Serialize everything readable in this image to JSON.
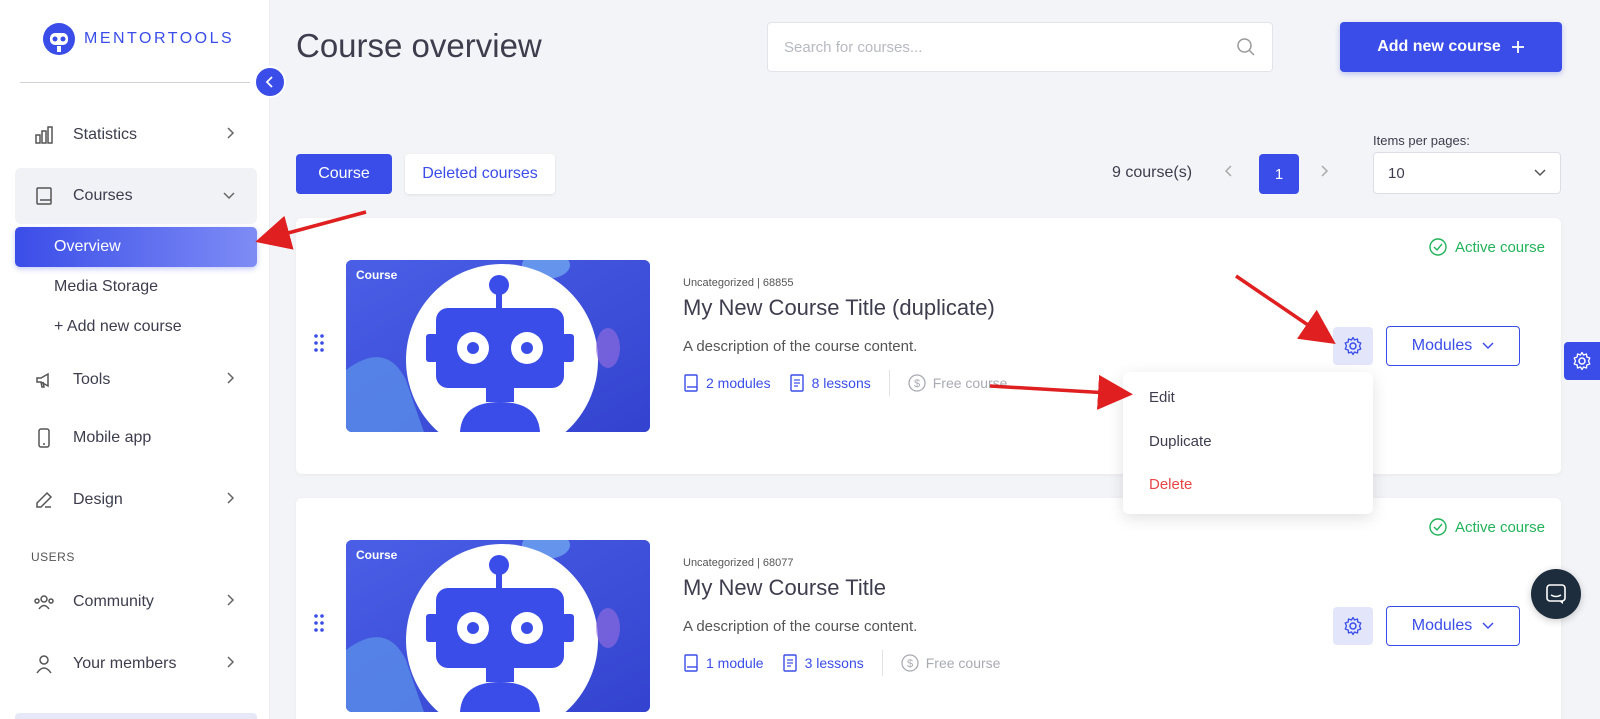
{
  "brand": {
    "name": "MENTORTOOLS"
  },
  "sidebar": {
    "items": [
      {
        "label": "Statistics",
        "icon": "bar-chart-icon"
      },
      {
        "label": "Courses",
        "icon": "book-icon"
      },
      {
        "label": "Tools",
        "icon": "megaphone-icon"
      },
      {
        "label": "Mobile app",
        "icon": "phone-icon"
      },
      {
        "label": "Design",
        "icon": "pencil-icon"
      }
    ],
    "courses_sub": {
      "overview": "Overview",
      "media": "Media Storage",
      "add": "+ Add new course"
    },
    "users_section": "USERS",
    "users_items": [
      {
        "label": "Community",
        "icon": "community-icon"
      },
      {
        "label": "Your members",
        "icon": "user-icon"
      }
    ]
  },
  "header": {
    "title": "Course overview",
    "search_placeholder": "Search for courses...",
    "add_button": "Add new course"
  },
  "toolbar": {
    "tabs": [
      "Course",
      "Deleted courses"
    ],
    "count": "9 course(s)",
    "page": "1",
    "items_per_page_label": "Items per pages:",
    "items_per_page_value": "10"
  },
  "courses": [
    {
      "thumb_label": "Course",
      "category": "Uncategorized | 68855",
      "title": "My New Course Title (duplicate)",
      "description": "A description of the course content.",
      "modules": "2 modules",
      "lessons": "8 lessons",
      "price": "Free course",
      "status": "Active course",
      "modules_button": "Modules"
    },
    {
      "thumb_label": "Course",
      "category": "Uncategorized | 68077",
      "title": "My New Course Title",
      "description": "A description of the course content.",
      "modules": "1 module",
      "lessons": "3 lessons",
      "price": "Free course",
      "status": "Active course",
      "modules_button": "Modules"
    }
  ],
  "dropdown": {
    "items": [
      "Edit",
      "Duplicate",
      "Delete"
    ]
  },
  "colors": {
    "accent": "#3a4de8",
    "success": "#22b35a",
    "danger": "#e84545",
    "annotation": "#e02020"
  }
}
